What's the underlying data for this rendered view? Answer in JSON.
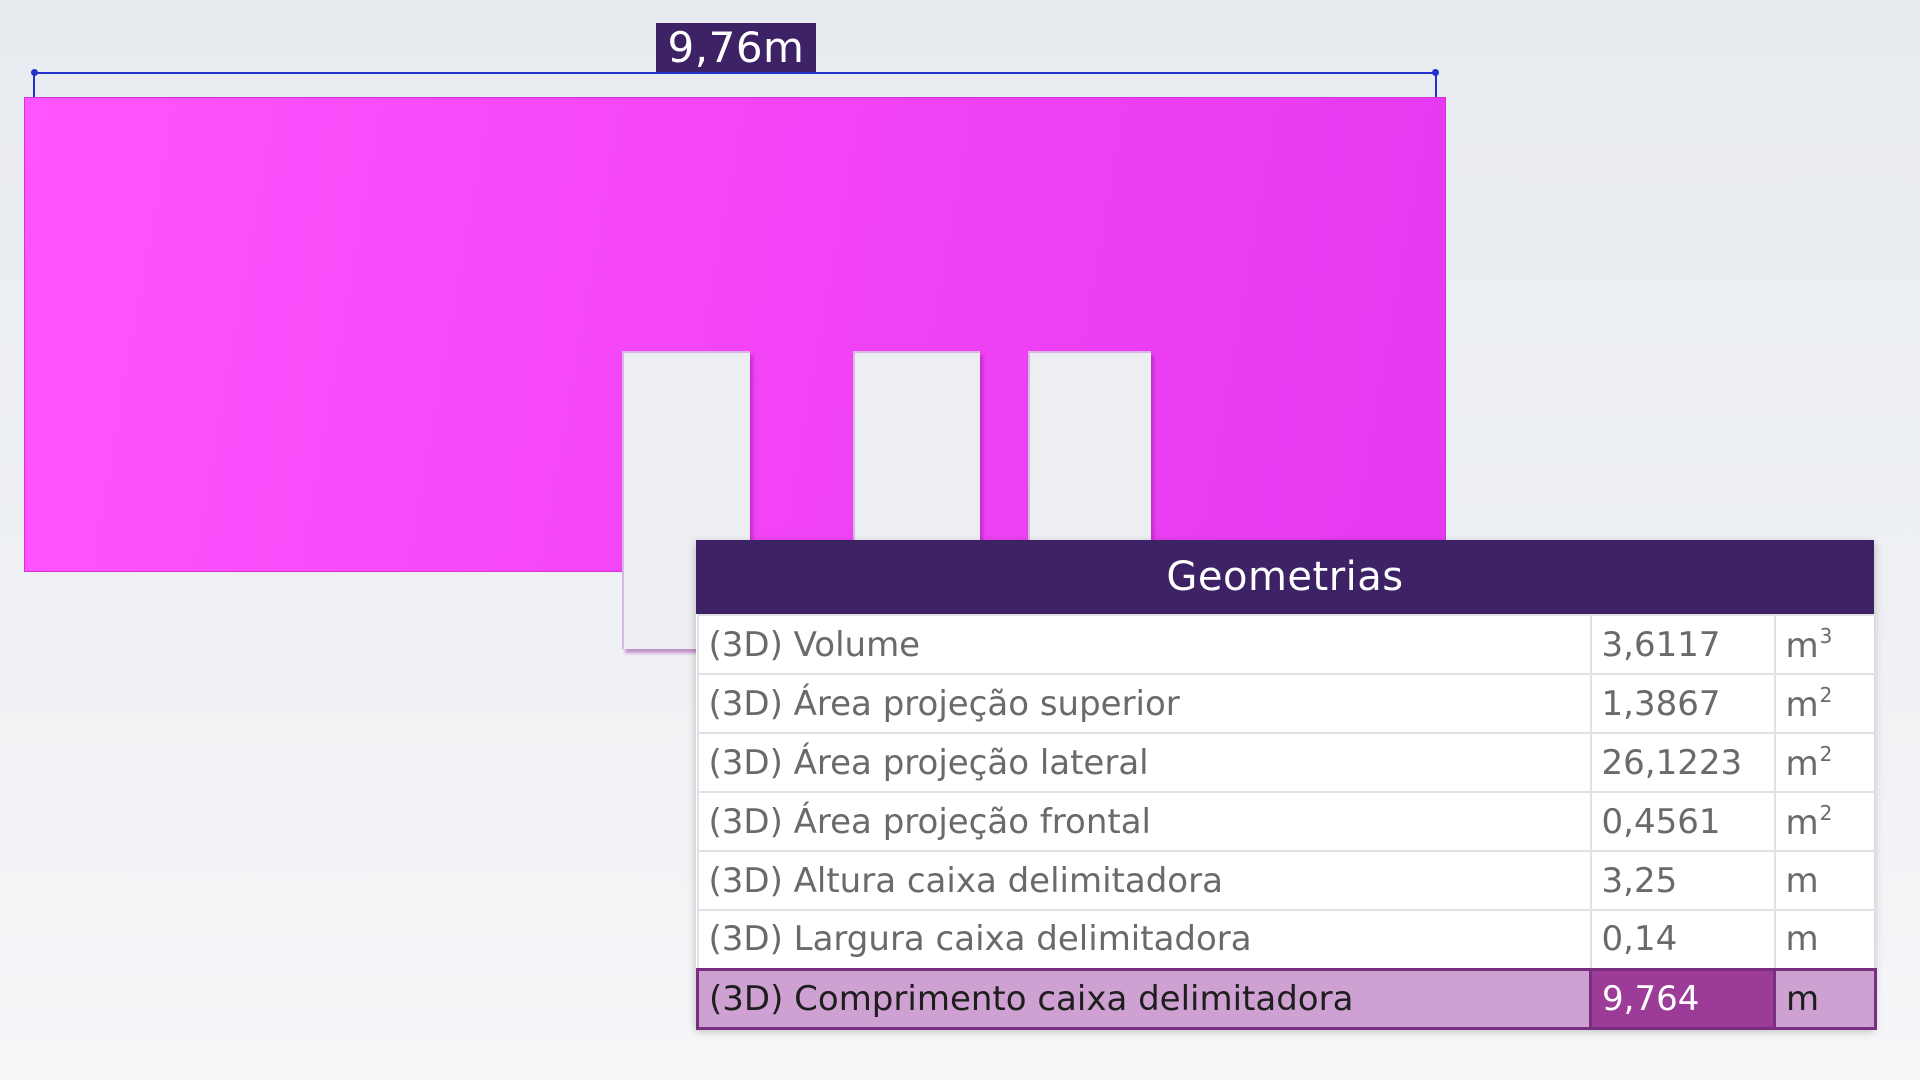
{
  "dimension": {
    "label": "9,76m"
  },
  "panel": {
    "title": "Geometrias",
    "rows": [
      {
        "name": "(3D) Volume",
        "value": "3,6117",
        "unit": "m",
        "exp": "3",
        "selected": false
      },
      {
        "name": "(3D) Área projeção superior",
        "value": "1,3867",
        "unit": "m",
        "exp": "2",
        "selected": false
      },
      {
        "name": "(3D) Área projeção lateral",
        "value": "26,1223",
        "unit": "m",
        "exp": "2",
        "selected": false
      },
      {
        "name": "(3D) Área projeção frontal",
        "value": "0,4561",
        "unit": "m",
        "exp": "2",
        "selected": false
      },
      {
        "name": "(3D) Altura caixa delimitadora",
        "value": "3,25",
        "unit": "m",
        "exp": "",
        "selected": false
      },
      {
        "name": "(3D) Largura caixa delimitadora",
        "value": "0,14",
        "unit": "m",
        "exp": "",
        "selected": false
      },
      {
        "name": "(3D) Comprimento caixa delimitadora",
        "value": "9,764",
        "unit": "m",
        "exp": "",
        "selected": true
      }
    ]
  },
  "colors": {
    "wall": "#f344f6",
    "header": "#3d2266",
    "dimension_line": "#2233cc",
    "selected_row": "#cfa0d2",
    "selected_value": "#9c3c98"
  }
}
